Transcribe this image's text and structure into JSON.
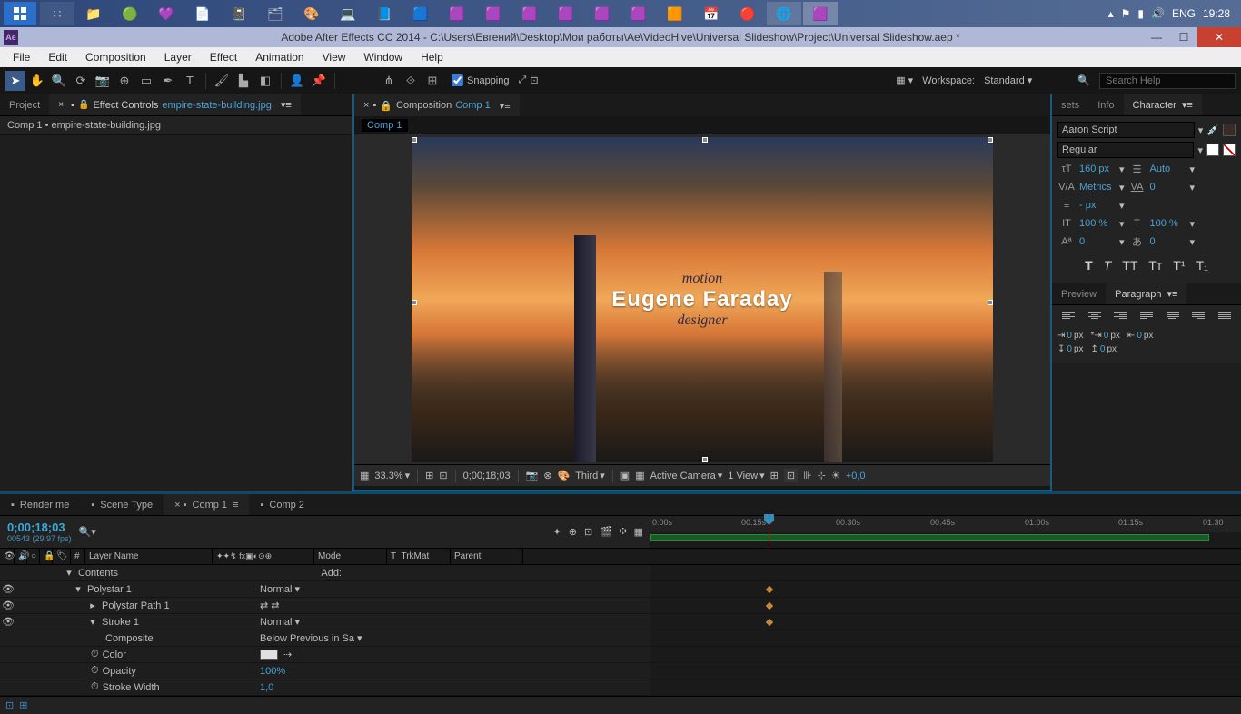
{
  "taskbar": {
    "lang": "ENG",
    "time": "19:28"
  },
  "titlebar": {
    "title": "Adobe After Effects CC 2014 - C:\\Users\\Евгений\\Desktop\\Мои работы\\Ae\\VideoHive\\Universal Slideshow\\Project\\Universal Slideshow.aep *"
  },
  "menubar": {
    "items": [
      "File",
      "Edit",
      "Composition",
      "Layer",
      "Effect",
      "Animation",
      "View",
      "Window",
      "Help"
    ]
  },
  "toolbar": {
    "snapping": "Snapping",
    "workspace_label": "Workspace:",
    "workspace_value": "Standard",
    "search_placeholder": "Search Help"
  },
  "left_panel": {
    "tabs": {
      "project": "Project",
      "effect_controls": "Effect Controls",
      "ec_file": "empire-state-building.jpg"
    },
    "subhead": "Comp 1 • empire-state-building.jpg"
  },
  "composition": {
    "panel_label": "Composition",
    "comp_name": "Comp 1",
    "sub_name": "Comp 1",
    "overlay": {
      "motion": "motion",
      "name": "Eugene Faraday",
      "designer": "designer"
    }
  },
  "viewer_footer": {
    "zoom": "33.3%",
    "timecode": "0;00;18;03",
    "third": "Third",
    "camera": "Active Camera",
    "view": "1 View",
    "offset": "+0,0"
  },
  "right_panel": {
    "tabs": {
      "sets": "sets",
      "info": "Info",
      "character": "Character"
    },
    "character": {
      "font": "Aaron Script",
      "style": "Regular",
      "size": "160",
      "size_unit": "px",
      "leading": "Auto",
      "kerning": "Metrics",
      "tracking": "0",
      "other_unit": "px",
      "vscale": "100",
      "hscale": "100",
      "percent": "%",
      "baseline": "0",
      "tsume": "0"
    },
    "para_tabs": {
      "preview": "Preview",
      "paragraph": "Paragraph"
    },
    "paragraph": {
      "indent": "0",
      "unit": "px"
    }
  },
  "timeline": {
    "tabs": {
      "render": "Render me",
      "scene": "Scene Type",
      "comp1": "Comp 1",
      "comp2": "Comp 2"
    },
    "timecode": "0;00;18;03",
    "frames": "00543 (29.97 fps)",
    "columns": {
      "layer_name": "Layer Name",
      "mode": "Mode",
      "trkmat": "TrkMat",
      "parent": "Parent"
    },
    "ruler": [
      "0:00s",
      "00:15s",
      "00:30s",
      "00:45s",
      "01:00s",
      "01:15s",
      "01:30"
    ],
    "layers": {
      "contents": "Contents",
      "polystar": "Polystar 1",
      "polystar_path": "Polystar Path 1",
      "stroke": "Stroke 1",
      "composite": "Composite",
      "composite_val": "Below Previous in Sa",
      "color": "Color",
      "opacity": "Opacity",
      "opacity_val": "100%",
      "stroke_width": "Stroke Width",
      "stroke_width_val": "1,0",
      "normal": "Normal",
      "add": "Add:"
    }
  }
}
